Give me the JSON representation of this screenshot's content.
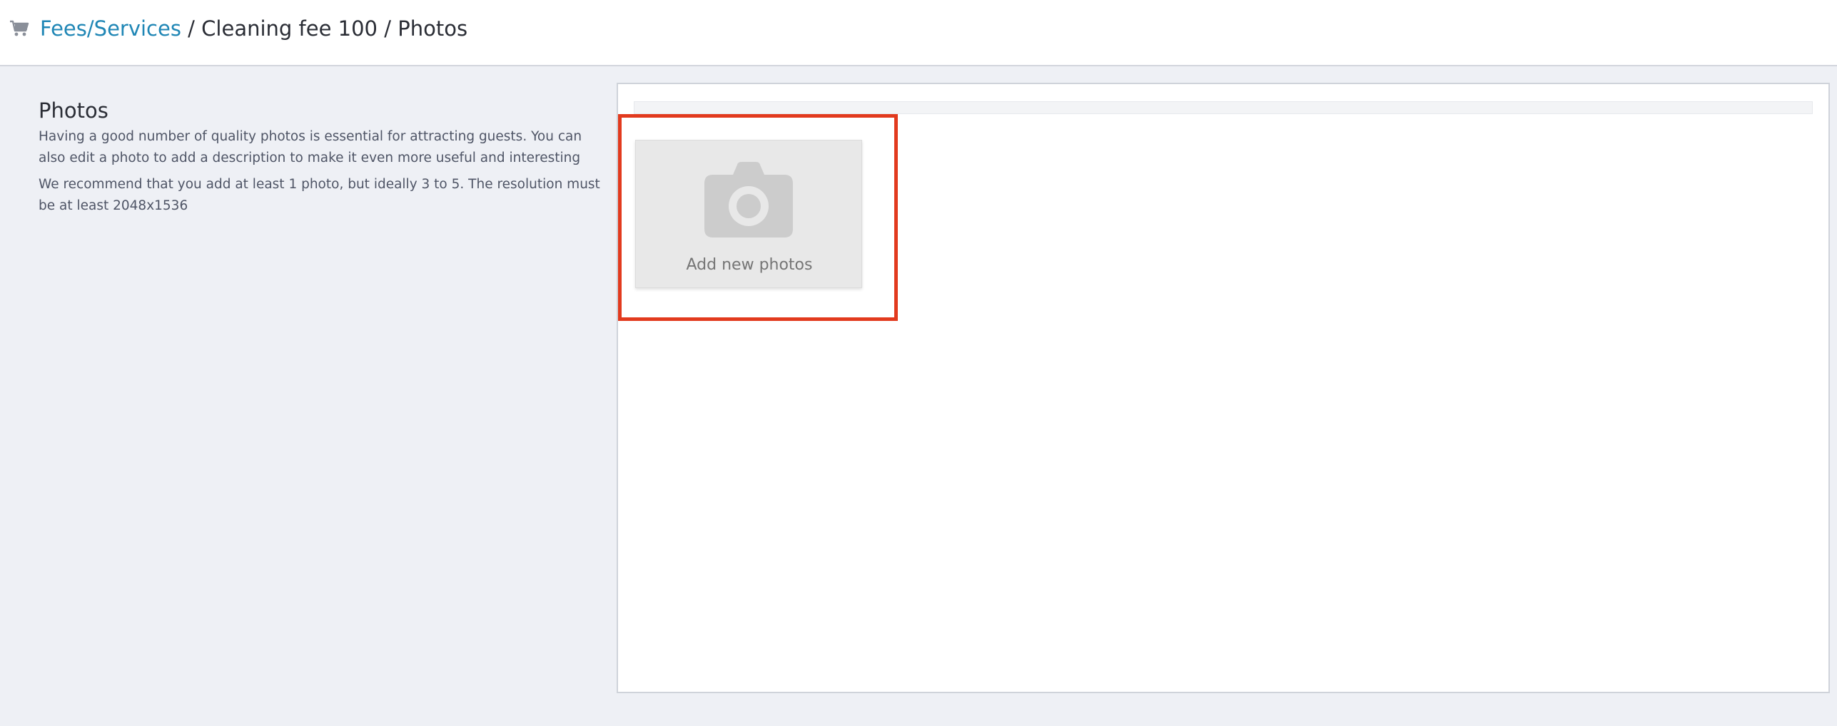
{
  "header": {
    "icon": "cart-icon",
    "breadcrumb": {
      "link_label": "Fees/Services",
      "separator": "/",
      "item_label": "Cleaning fee 100",
      "current_label": "Photos"
    }
  },
  "photos_section": {
    "title": "Photos",
    "description_1": "Having a good number of quality photos is essential for attracting guests. You can also edit a photo to add a description to make it even more useful and interesting",
    "description_2": "We recommend that you add at least 1 photo, but ideally 3 to 5. The resolution must be at least 2048x1536"
  },
  "uploader": {
    "add_label": "Add new photos",
    "icon": "camera-icon"
  },
  "colors": {
    "link": "#1f86b5",
    "highlight": "#e23a1e",
    "background": "#eef0f5"
  }
}
